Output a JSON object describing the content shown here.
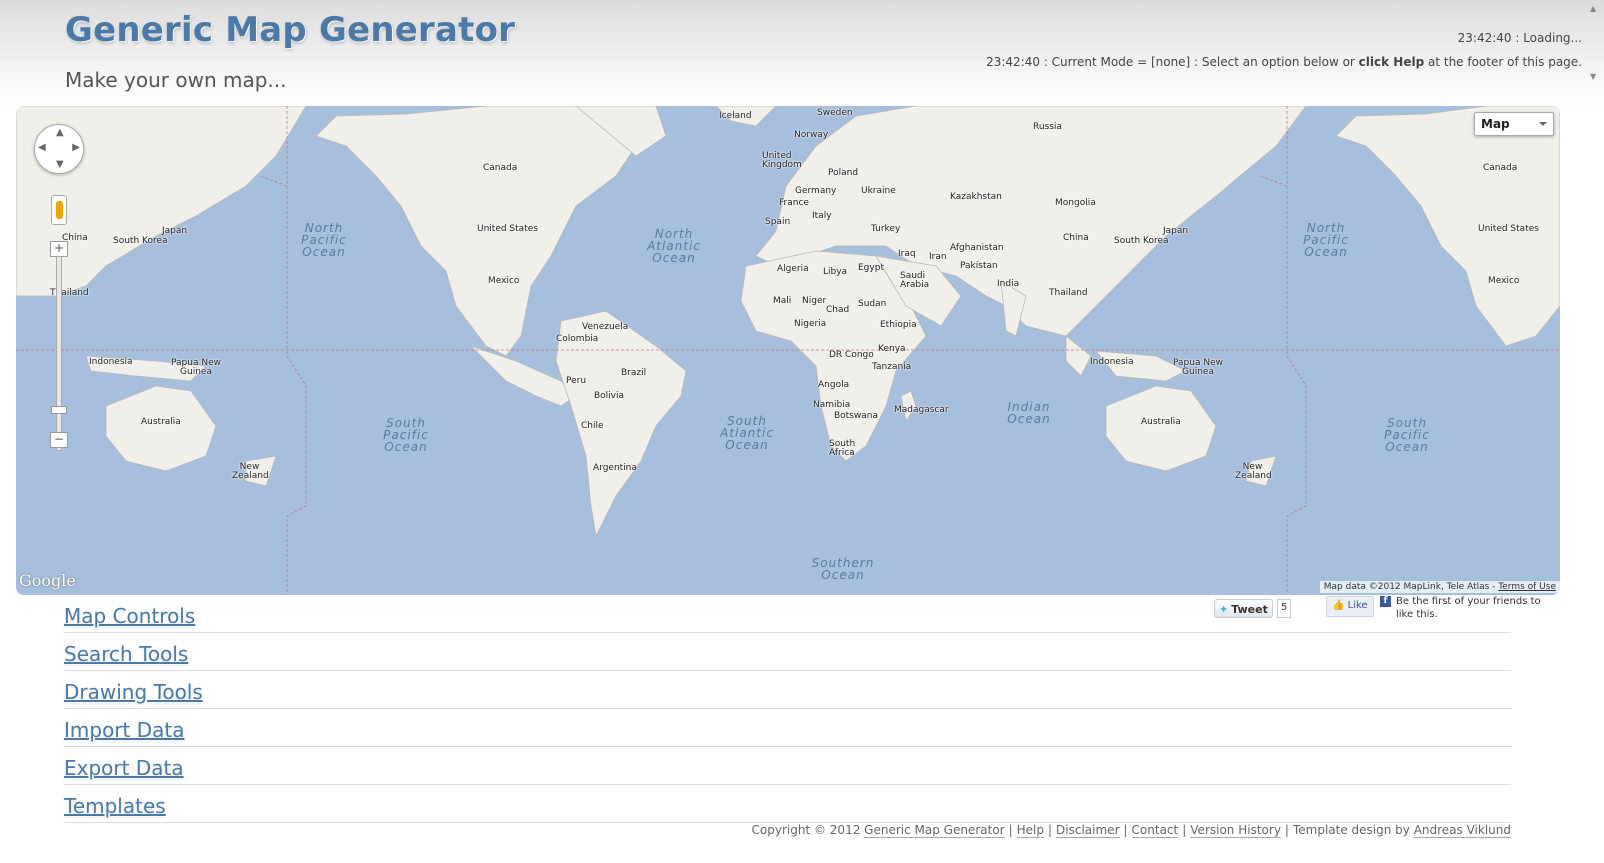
{
  "header": {
    "title": "Generic Map Generator",
    "subtitle": "Make your own map...",
    "status_line1": "23:42:40 : Loading...",
    "status_line2_prefix": "23:42:40 : Current Mode = [none] : Select an option below or ",
    "status_line2_bold": "click Help",
    "status_line2_suffix": " at the footer of this page."
  },
  "map": {
    "type_selector": "Map",
    "google_logo": "Google",
    "attribution": "Map data ©2012 MapLink, Tele Atlas - ",
    "terms": "Terms of Use",
    "colors": {
      "water": "#a5bfdd",
      "land": "#f1efe9"
    },
    "countries": {
      "iceland": "Iceland",
      "sweden": "Sweden",
      "russia": "Russia",
      "norway": "Norway",
      "uk": "United Kingdom",
      "poland": "Poland",
      "germany": "Germany",
      "ukraine": "Ukraine",
      "kazakhstan": "Kazakhstan",
      "mongolia": "Mongolia",
      "france": "France",
      "italy": "Italy",
      "spain": "Spain",
      "turkey": "Turkey",
      "china": "China",
      "south_korea": "South Korea",
      "japan": "Japan",
      "afghanistan": "Afghanistan",
      "iraq": "Iraq",
      "iran": "Iran",
      "pakistan": "Pakistan",
      "algeria": "Algeria",
      "libya": "Libya",
      "egypt": "Egypt",
      "saudi_arabia": "Saudi Arabia",
      "india": "India",
      "thailand": "Thailand",
      "mali": "Mali",
      "niger": "Niger",
      "chad": "Chad",
      "sudan": "Sudan",
      "nigeria": "Nigeria",
      "ethiopia": "Ethiopia",
      "kenya": "Kenya",
      "dr_congo": "DR Congo",
      "tanzania": "Tanzania",
      "angola": "Angola",
      "namibia": "Namibia",
      "botswana": "Botswana",
      "madagascar": "Madagascar",
      "south_africa": "South Africa",
      "canada": "Canada",
      "united_states": "United States",
      "mexico": "Mexico",
      "venezuela": "Venezuela",
      "colombia": "Colombia",
      "brazil": "Brazil",
      "peru": "Peru",
      "bolivia": "Bolivia",
      "chile": "Chile",
      "argentina": "Argentina",
      "indonesia": "Indonesia",
      "papua": "Papua New Guinea",
      "australia": "Australia",
      "new_zealand": "New Zealand"
    },
    "oceans": {
      "north_pacific": "North Pacific Ocean",
      "north_atlantic": "North Atlantic Ocean",
      "south_pacific": "South Pacific Ocean",
      "south_atlantic": "South Atlantic Ocean",
      "indian": "Indian Ocean",
      "southern": "Southern Ocean"
    }
  },
  "sections": [
    "Map Controls",
    "Search Tools",
    "Drawing Tools",
    "Import Data",
    "Export Data",
    "Templates"
  ],
  "social": {
    "tweet_label": "Tweet",
    "tweet_count": "5",
    "like_label": "Like",
    "fb_text": "Be the first of your friends to like this."
  },
  "footer": {
    "copyright": "Copyright © 2012 ",
    "links": [
      "Generic Map Generator",
      "Help",
      "Disclaimer",
      "Contact",
      "Version History"
    ],
    "design_prefix": "Template design by ",
    "designer": "Andreas Viklund"
  }
}
